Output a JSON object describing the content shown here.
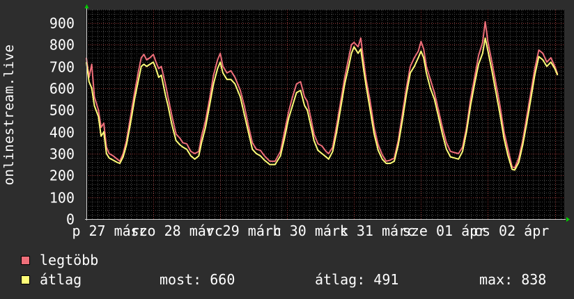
{
  "chart_data": {
    "type": "line",
    "ylabel": "onlinestream.live",
    "ylim": [
      0,
      960
    ],
    "yticks": [
      0,
      100,
      200,
      300,
      400,
      500,
      600,
      700,
      800,
      900
    ],
    "xlim": [
      0,
      7.14
    ],
    "xticks": [
      {
        "x": 0.35,
        "label": "p 27 márc"
      },
      {
        "x": 1.35,
        "label": "szo 28 márc"
      },
      {
        "x": 2.35,
        "label": "v 29 márc"
      },
      {
        "x": 3.35,
        "label": "h 30 márc"
      },
      {
        "x": 4.35,
        "label": "k 31 márc"
      },
      {
        "x": 5.35,
        "label": "sze 01 ápr"
      },
      {
        "x": 6.35,
        "label": "cs 02 ápr"
      }
    ],
    "grid": true,
    "series": [
      {
        "name": "legtöbb",
        "color": "#ef6f7a",
        "points": [
          [
            0.0,
            740
          ],
          [
            0.04,
            650
          ],
          [
            0.08,
            710
          ],
          [
            0.12,
            560
          ],
          [
            0.18,
            500
          ],
          [
            0.22,
            420
          ],
          [
            0.26,
            440
          ],
          [
            0.3,
            330
          ],
          [
            0.34,
            300
          ],
          [
            0.4,
            290
          ],
          [
            0.46,
            275
          ],
          [
            0.5,
            265
          ],
          [
            0.55,
            300
          ],
          [
            0.6,
            360
          ],
          [
            0.66,
            470
          ],
          [
            0.72,
            580
          ],
          [
            0.78,
            680
          ],
          [
            0.82,
            740
          ],
          [
            0.86,
            755
          ],
          [
            0.9,
            730
          ],
          [
            0.95,
            740
          ],
          [
            1.0,
            755
          ],
          [
            1.04,
            720
          ],
          [
            1.08,
            690
          ],
          [
            1.12,
            700
          ],
          [
            1.18,
            620
          ],
          [
            1.22,
            560
          ],
          [
            1.28,
            470
          ],
          [
            1.34,
            390
          ],
          [
            1.4,
            370
          ],
          [
            1.44,
            350
          ],
          [
            1.5,
            345
          ],
          [
            1.56,
            310
          ],
          [
            1.62,
            300
          ],
          [
            1.68,
            310
          ],
          [
            1.72,
            380
          ],
          [
            1.78,
            450
          ],
          [
            1.84,
            550
          ],
          [
            1.9,
            660
          ],
          [
            1.96,
            730
          ],
          [
            2.0,
            760
          ],
          [
            2.04,
            700
          ],
          [
            2.1,
            670
          ],
          [
            2.16,
            680
          ],
          [
            2.22,
            650
          ],
          [
            2.3,
            590
          ],
          [
            2.36,
            520
          ],
          [
            2.42,
            430
          ],
          [
            2.48,
            350
          ],
          [
            2.54,
            320
          ],
          [
            2.6,
            315
          ],
          [
            2.66,
            290
          ],
          [
            2.74,
            265
          ],
          [
            2.82,
            265
          ],
          [
            2.9,
            310
          ],
          [
            2.96,
            400
          ],
          [
            3.02,
            490
          ],
          [
            3.08,
            560
          ],
          [
            3.14,
            620
          ],
          [
            3.2,
            630
          ],
          [
            3.26,
            560
          ],
          [
            3.3,
            540
          ],
          [
            3.36,
            455
          ],
          [
            3.4,
            390
          ],
          [
            3.46,
            345
          ],
          [
            3.52,
            335
          ],
          [
            3.58,
            310
          ],
          [
            3.62,
            300
          ],
          [
            3.68,
            330
          ],
          [
            3.74,
            430
          ],
          [
            3.8,
            540
          ],
          [
            3.86,
            650
          ],
          [
            3.92,
            740
          ],
          [
            3.96,
            800
          ],
          [
            4.0,
            810
          ],
          [
            4.06,
            790
          ],
          [
            4.1,
            830
          ],
          [
            4.14,
            730
          ],
          [
            4.18,
            640
          ],
          [
            4.24,
            540
          ],
          [
            4.3,
            420
          ],
          [
            4.36,
            340
          ],
          [
            4.42,
            295
          ],
          [
            4.48,
            265
          ],
          [
            4.54,
            270
          ],
          [
            4.6,
            280
          ],
          [
            4.66,
            360
          ],
          [
            4.72,
            480
          ],
          [
            4.78,
            600
          ],
          [
            4.84,
            700
          ],
          [
            4.9,
            740
          ],
          [
            4.96,
            770
          ],
          [
            5.0,
            815
          ],
          [
            5.04,
            780
          ],
          [
            5.08,
            700
          ],
          [
            5.14,
            640
          ],
          [
            5.2,
            580
          ],
          [
            5.26,
            500
          ],
          [
            5.32,
            420
          ],
          [
            5.38,
            350
          ],
          [
            5.44,
            310
          ],
          [
            5.5,
            305
          ],
          [
            5.56,
            300
          ],
          [
            5.62,
            330
          ],
          [
            5.68,
            420
          ],
          [
            5.74,
            550
          ],
          [
            5.8,
            650
          ],
          [
            5.86,
            750
          ],
          [
            5.92,
            810
          ],
          [
            5.96,
            905
          ],
          [
            6.0,
            810
          ],
          [
            6.06,
            720
          ],
          [
            6.12,
            620
          ],
          [
            6.18,
            520
          ],
          [
            6.24,
            400
          ],
          [
            6.3,
            320
          ],
          [
            6.36,
            240
          ],
          [
            6.4,
            235
          ],
          [
            6.46,
            280
          ],
          [
            6.52,
            360
          ],
          [
            6.58,
            470
          ],
          [
            6.64,
            580
          ],
          [
            6.7,
            690
          ],
          [
            6.76,
            775
          ],
          [
            6.82,
            760
          ],
          [
            6.88,
            720
          ],
          [
            6.94,
            740
          ],
          [
            7.0,
            700
          ],
          [
            7.04,
            665
          ]
        ]
      },
      {
        "name": "átlag",
        "color": "#fffe78",
        "points": [
          [
            0.0,
            720
          ],
          [
            0.04,
            630
          ],
          [
            0.08,
            600
          ],
          [
            0.12,
            520
          ],
          [
            0.18,
            470
          ],
          [
            0.22,
            380
          ],
          [
            0.26,
            400
          ],
          [
            0.3,
            300
          ],
          [
            0.34,
            280
          ],
          [
            0.4,
            270
          ],
          [
            0.46,
            260
          ],
          [
            0.5,
            255
          ],
          [
            0.55,
            285
          ],
          [
            0.6,
            340
          ],
          [
            0.66,
            440
          ],
          [
            0.72,
            550
          ],
          [
            0.78,
            640
          ],
          [
            0.82,
            700
          ],
          [
            0.86,
            710
          ],
          [
            0.9,
            700
          ],
          [
            0.95,
            710
          ],
          [
            1.0,
            720
          ],
          [
            1.04,
            690
          ],
          [
            1.08,
            650
          ],
          [
            1.12,
            660
          ],
          [
            1.18,
            570
          ],
          [
            1.22,
            520
          ],
          [
            1.28,
            430
          ],
          [
            1.34,
            360
          ],
          [
            1.4,
            340
          ],
          [
            1.44,
            330
          ],
          [
            1.5,
            320
          ],
          [
            1.56,
            290
          ],
          [
            1.62,
            275
          ],
          [
            1.68,
            290
          ],
          [
            1.72,
            350
          ],
          [
            1.78,
            420
          ],
          [
            1.84,
            520
          ],
          [
            1.9,
            620
          ],
          [
            1.96,
            690
          ],
          [
            2.0,
            720
          ],
          [
            2.04,
            670
          ],
          [
            2.1,
            640
          ],
          [
            2.16,
            640
          ],
          [
            2.22,
            620
          ],
          [
            2.3,
            560
          ],
          [
            2.36,
            480
          ],
          [
            2.42,
            400
          ],
          [
            2.48,
            320
          ],
          [
            2.54,
            300
          ],
          [
            2.6,
            290
          ],
          [
            2.66,
            270
          ],
          [
            2.74,
            250
          ],
          [
            2.82,
            250
          ],
          [
            2.9,
            290
          ],
          [
            2.96,
            370
          ],
          [
            3.02,
            460
          ],
          [
            3.08,
            520
          ],
          [
            3.14,
            580
          ],
          [
            3.2,
            590
          ],
          [
            3.26,
            520
          ],
          [
            3.3,
            500
          ],
          [
            3.36,
            420
          ],
          [
            3.4,
            360
          ],
          [
            3.46,
            315
          ],
          [
            3.52,
            300
          ],
          [
            3.58,
            285
          ],
          [
            3.62,
            275
          ],
          [
            3.68,
            310
          ],
          [
            3.74,
            400
          ],
          [
            3.8,
            510
          ],
          [
            3.86,
            620
          ],
          [
            3.92,
            700
          ],
          [
            3.96,
            760
          ],
          [
            4.0,
            790
          ],
          [
            4.06,
            760
          ],
          [
            4.1,
            780
          ],
          [
            4.14,
            690
          ],
          [
            4.18,
            610
          ],
          [
            4.24,
            500
          ],
          [
            4.3,
            390
          ],
          [
            4.36,
            315
          ],
          [
            4.42,
            275
          ],
          [
            4.48,
            255
          ],
          [
            4.54,
            255
          ],
          [
            4.6,
            265
          ],
          [
            4.66,
            340
          ],
          [
            4.72,
            450
          ],
          [
            4.78,
            570
          ],
          [
            4.84,
            670
          ],
          [
            4.9,
            700
          ],
          [
            4.96,
            740
          ],
          [
            5.0,
            770
          ],
          [
            5.04,
            740
          ],
          [
            5.08,
            670
          ],
          [
            5.14,
            600
          ],
          [
            5.2,
            550
          ],
          [
            5.26,
            470
          ],
          [
            5.32,
            390
          ],
          [
            5.38,
            320
          ],
          [
            5.44,
            285
          ],
          [
            5.5,
            280
          ],
          [
            5.56,
            275
          ],
          [
            5.62,
            310
          ],
          [
            5.68,
            400
          ],
          [
            5.74,
            520
          ],
          [
            5.8,
            620
          ],
          [
            5.86,
            710
          ],
          [
            5.92,
            760
          ],
          [
            5.96,
            830
          ],
          [
            6.0,
            770
          ],
          [
            6.06,
            680
          ],
          [
            6.12,
            580
          ],
          [
            6.18,
            480
          ],
          [
            6.24,
            370
          ],
          [
            6.3,
            290
          ],
          [
            6.36,
            228
          ],
          [
            6.4,
            225
          ],
          [
            6.46,
            260
          ],
          [
            6.52,
            340
          ],
          [
            6.58,
            440
          ],
          [
            6.64,
            550
          ],
          [
            6.7,
            660
          ],
          [
            6.76,
            745
          ],
          [
            6.82,
            730
          ],
          [
            6.88,
            700
          ],
          [
            6.94,
            720
          ],
          [
            7.0,
            690
          ],
          [
            7.04,
            660
          ]
        ]
      }
    ]
  },
  "legend": {
    "max_label": "legtöbb",
    "avg_label": "átlag",
    "max_color": "#ef6f7a",
    "avg_color": "#fffe78"
  },
  "stats": {
    "current": "most: 660",
    "average": "átlag: 491",
    "maximum": "max: 838"
  }
}
